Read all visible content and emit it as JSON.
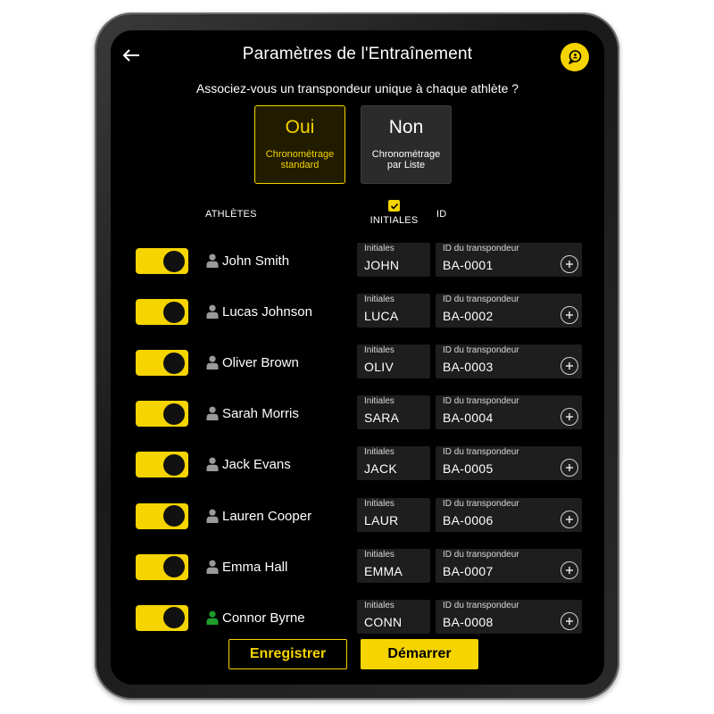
{
  "header": {
    "title": "Paramètres de l'Entraînement",
    "back_icon": "arrow-left-icon",
    "chat_icon": "chat-bubble-icon"
  },
  "question": "Associez-vous un transpondeur unique à chaque athlète ?",
  "choices": {
    "oui": {
      "label": "Oui",
      "sub": "Chronométrage standard",
      "selected": true
    },
    "non": {
      "label": "Non",
      "sub": "Chronométrage par Liste",
      "selected": false
    }
  },
  "columns": {
    "athletes": "ATHLÈTES",
    "initiales": "INITIALES",
    "initiales_checked": true,
    "id": "ID"
  },
  "field_labels": {
    "initiales": "Initiales",
    "transponder": "ID du transpondeur"
  },
  "athletes": [
    {
      "name": "John Smith",
      "initials": "JOHN",
      "transponder": "BA-0001",
      "enabled": true,
      "icon_color": "#9a9a9a"
    },
    {
      "name": "Lucas Johnson",
      "initials": "LUCA",
      "transponder": "BA-0002",
      "enabled": true,
      "icon_color": "#9a9a9a"
    },
    {
      "name": "Oliver Brown",
      "initials": "OLIV",
      "transponder": "BA-0003",
      "enabled": true,
      "icon_color": "#9a9a9a"
    },
    {
      "name": "Sarah Morris",
      "initials": "SARA",
      "transponder": "BA-0004",
      "enabled": true,
      "icon_color": "#9a9a9a"
    },
    {
      "name": "Jack Evans",
      "initials": "JACK",
      "transponder": "BA-0005",
      "enabled": true,
      "icon_color": "#9a9a9a"
    },
    {
      "name": "Lauren Cooper",
      "initials": "LAUR",
      "transponder": "BA-0006",
      "enabled": true,
      "icon_color": "#9a9a9a"
    },
    {
      "name": "Emma Hall",
      "initials": "EMMA",
      "transponder": "BA-0007",
      "enabled": true,
      "icon_color": "#9a9a9a"
    },
    {
      "name": "Connor Byrne",
      "initials": "CONN",
      "transponder": "BA-0008",
      "enabled": true,
      "icon_color": "#1f9d2a"
    }
  ],
  "footer": {
    "save_label": "Enregistrer",
    "start_label": "Démarrer"
  },
  "colors": {
    "accent": "#f5d400",
    "background": "#000000",
    "field": "#1e1e1e"
  }
}
